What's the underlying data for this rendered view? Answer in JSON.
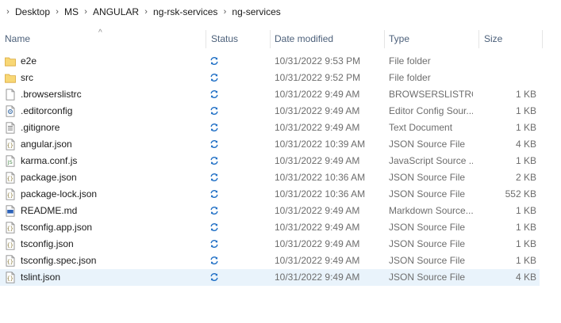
{
  "breadcrumb": {
    "items": [
      "Desktop",
      "MS",
      "ANGULAR",
      "ng-rsk-services",
      "ng-services"
    ],
    "separator": "›"
  },
  "columns": {
    "name": "Name",
    "status": "Status",
    "date": "Date modified",
    "type": "Type",
    "size": "Size"
  },
  "files": [
    {
      "name": "e2e",
      "date": "10/31/2022 9:53 PM",
      "type": "File folder",
      "size": "",
      "icon": "folder-icon"
    },
    {
      "name": "src",
      "date": "10/31/2022 9:52 PM",
      "type": "File folder",
      "size": "",
      "icon": "folder-icon"
    },
    {
      "name": ".browserslistrc",
      "date": "10/31/2022 9:49 AM",
      "type": "BROWSERSLISTRC...",
      "size": "1 KB",
      "icon": "blank-file-icon"
    },
    {
      "name": ".editorconfig",
      "date": "10/31/2022 9:49 AM",
      "type": "Editor Config Sour...",
      "size": "1 KB",
      "icon": "config-file-icon"
    },
    {
      "name": ".gitignore",
      "date": "10/31/2022 9:49 AM",
      "type": "Text Document",
      "size": "1 KB",
      "icon": "text-file-icon"
    },
    {
      "name": "angular.json",
      "date": "10/31/2022 10:39 AM",
      "type": "JSON Source File",
      "size": "4 KB",
      "icon": "json-file-icon"
    },
    {
      "name": "karma.conf.js",
      "date": "10/31/2022 9:49 AM",
      "type": "JavaScript Source ...",
      "size": "1 KB",
      "icon": "js-file-icon"
    },
    {
      "name": "package.json",
      "date": "10/31/2022 10:36 AM",
      "type": "JSON Source File",
      "size": "2 KB",
      "icon": "json-file-icon"
    },
    {
      "name": "package-lock.json",
      "date": "10/31/2022 10:36 AM",
      "type": "JSON Source File",
      "size": "552 KB",
      "icon": "json-file-icon"
    },
    {
      "name": "README.md",
      "date": "10/31/2022 9:49 AM",
      "type": "Markdown Source...",
      "size": "1 KB",
      "icon": "markdown-file-icon"
    },
    {
      "name": "tsconfig.app.json",
      "date": "10/31/2022 9:49 AM",
      "type": "JSON Source File",
      "size": "1 KB",
      "icon": "json-file-icon"
    },
    {
      "name": "tsconfig.json",
      "date": "10/31/2022 9:49 AM",
      "type": "JSON Source File",
      "size": "1 KB",
      "icon": "json-file-icon"
    },
    {
      "name": "tsconfig.spec.json",
      "date": "10/31/2022 9:49 AM",
      "type": "JSON Source File",
      "size": "1 KB",
      "icon": "json-file-icon"
    },
    {
      "name": "tslint.json",
      "date": "10/31/2022 9:49 AM",
      "type": "JSON Source File",
      "size": "4 KB",
      "icon": "json-file-icon",
      "selected": true
    }
  ],
  "colors": {
    "folder": "#f8d775",
    "sync_icon": "#1f6fc5",
    "selection": "#e9f3fb",
    "header_text": "#4c607a"
  }
}
